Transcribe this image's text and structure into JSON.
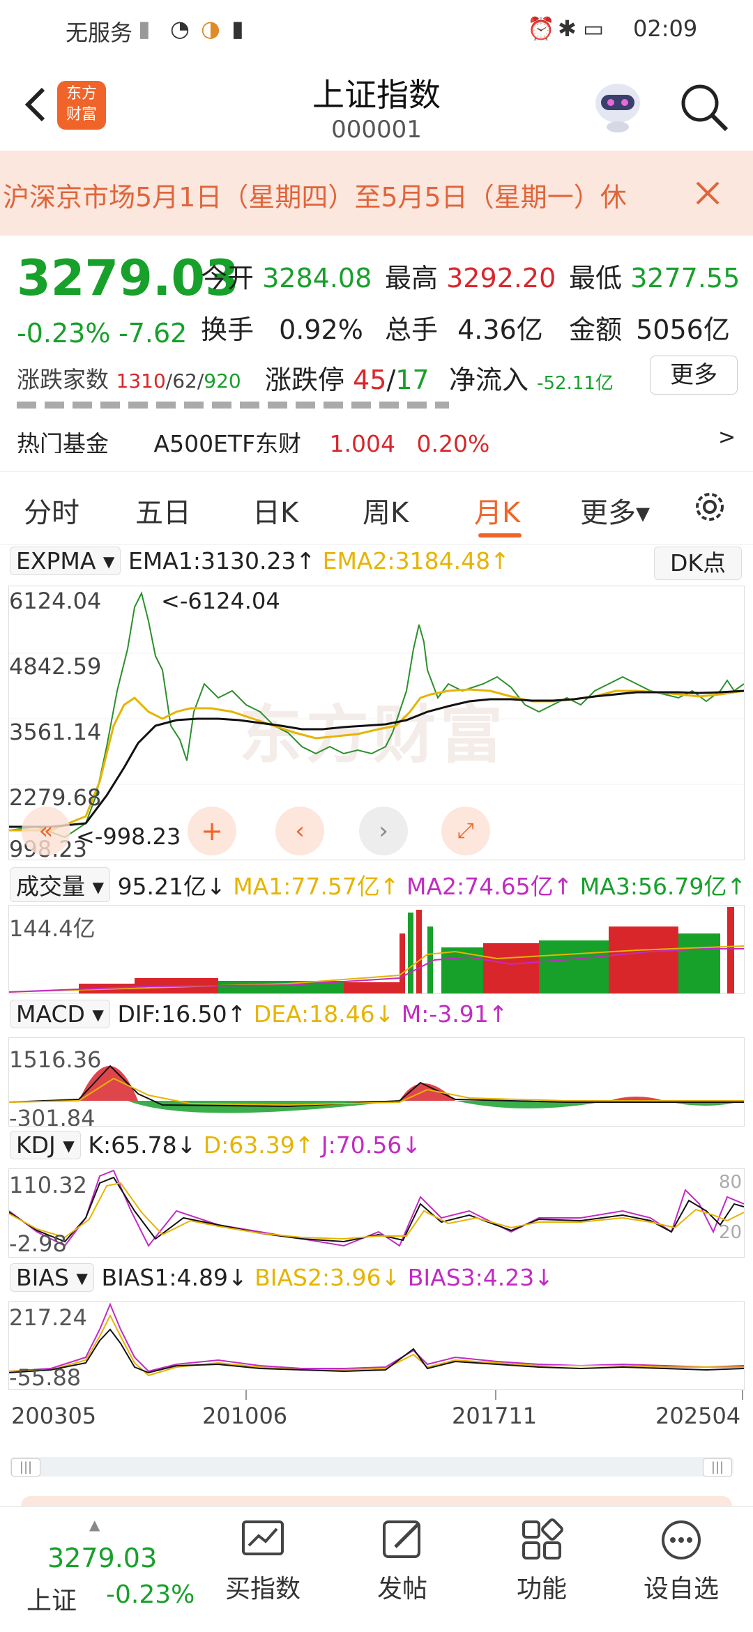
{
  "status_bar": {
    "carrier": "无服务",
    "time": "02:09"
  },
  "header": {
    "title": "上证指数",
    "code": "000001",
    "logo_text": "东方财富"
  },
  "banner": {
    "text": "沪深京市场5月1日（星期四）至5月5日（星期一）休"
  },
  "quote": {
    "price": "3279.03",
    "change_pct": "-0.23%",
    "change": "-7.62",
    "open_label": "今开",
    "open": "3284.08",
    "high_label": "最高",
    "high": "3292.20",
    "low_label": "最低",
    "low": "3277.55",
    "turnover_label": "换手",
    "turnover": "0.92%",
    "volume_label": "总手",
    "volume": "4.36亿",
    "amount_label": "金额",
    "amount": "5056亿",
    "updown_label": "涨跌家数",
    "up": "1310",
    "flat": "62",
    "down": "920",
    "limit_label": "涨跌停",
    "limit_up": "45",
    "limit_down": "17",
    "inflow_label": "净流入",
    "inflow": "-52.11亿",
    "more_label": "更多",
    "hot_fund_label": "热门基金",
    "hot_fund_name": "A500ETF东财",
    "hot_fund_price": "1.004",
    "hot_fund_pct": "0.20%"
  },
  "tabs": [
    {
      "label": "分时"
    },
    {
      "label": "五日"
    },
    {
      "label": "日K"
    },
    {
      "label": "周K"
    },
    {
      "label": "月K",
      "active": true
    },
    {
      "label": "更多▾"
    }
  ],
  "expma": {
    "name": "EXPMA",
    "ema1": "EMA1:3130.23↑",
    "ema2": "EMA2:3184.48↑",
    "dk_label": "DK点",
    "y_labels": [
      "6124.04",
      "4842.59",
      "3561.14",
      "2279.68",
      "998.23"
    ],
    "max_marker": "<-6124.04",
    "min_marker": "<-998.23",
    "watermark": "东方财富"
  },
  "volume": {
    "name": "成交量",
    "value": "95.21亿↓",
    "ma1": "MA1:77.57亿↑",
    "ma2": "MA2:74.65亿↑",
    "ma3": "MA3:56.79亿↑",
    "y_label": "144.4亿"
  },
  "macd": {
    "name": "MACD",
    "dif": "DIF:16.50↑",
    "dea": "DEA:18.46↓",
    "m": "M:-3.91↑",
    "y_top": "1516.36",
    "y_bottom": "-301.84"
  },
  "kdj": {
    "name": "KDJ",
    "k": "K:65.78↓",
    "d": "D:63.39↑",
    "j": "J:70.56↓",
    "y_top": "110.32",
    "y_bottom": "-2.98",
    "r80": "80",
    "r20": "20"
  },
  "bias": {
    "name": "BIAS",
    "b1": "BIAS1:4.89↓",
    "b2": "BIAS2:3.96↓",
    "b3": "BIAS3:4.23↓",
    "y_top": "217.24",
    "y_bottom": "-55.88"
  },
  "x_axis": [
    "200305",
    "201006",
    "201711",
    "202504"
  ],
  "bottom_nav": {
    "price": "3279.03",
    "name": "上证",
    "pct": "-0.23%",
    "items": [
      {
        "label": "买指数"
      },
      {
        "label": "发帖"
      },
      {
        "label": "功能"
      },
      {
        "label": "设自选"
      }
    ]
  },
  "colors": {
    "up": "#d9262b",
    "down": "#17a02a",
    "accent": "#f0642a",
    "yellow": "#e6b400",
    "magenta": "#c22bc2"
  }
}
